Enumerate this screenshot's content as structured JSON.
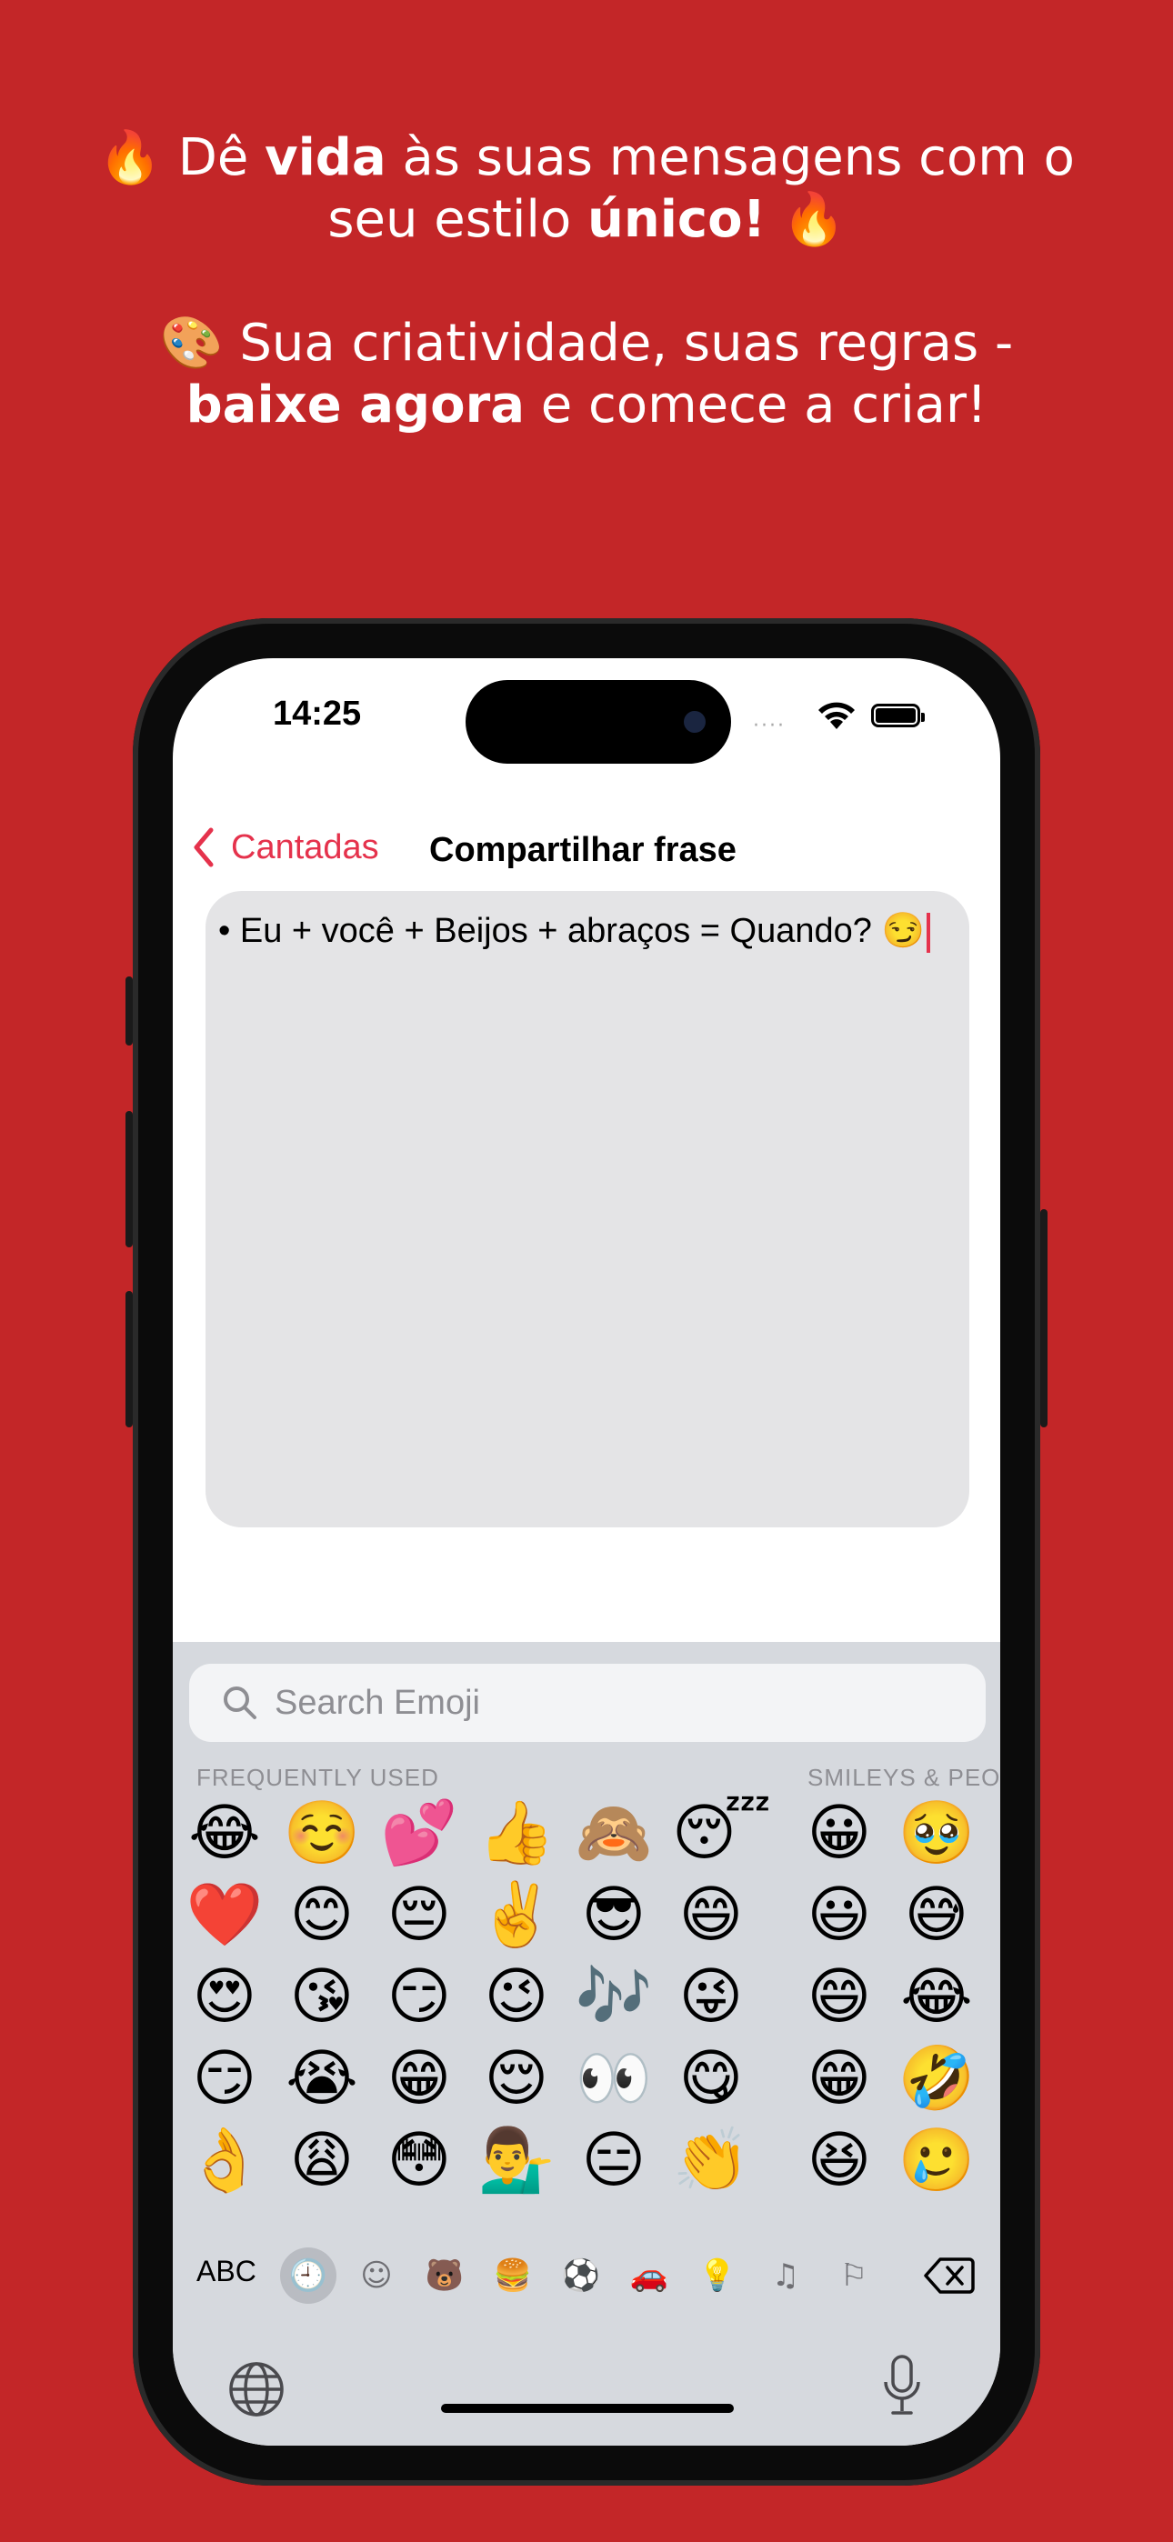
{
  "promo": {
    "line1_icon": "🔥",
    "line1_a": " Dê ",
    "line1_bold": "vida",
    "line1_b": " às suas mensagens com o",
    "line2_a": "seu estilo ",
    "line2_bold": "único!",
    "line2_icon": " 🔥",
    "line3_icon": "🎨",
    "line3_a": " Sua criatividade, suas regras -",
    "line4_bold": "baixe agora",
    "line4_a": " e comece a criar!"
  },
  "status": {
    "time": "14:25",
    "signal": "····"
  },
  "nav": {
    "back_label": "Cantadas",
    "title": "Compartilhar frase"
  },
  "text_area": {
    "value": "• Eu + você + Beijos + abraços = Quando? 😏"
  },
  "keyboard": {
    "search_placeholder": "Search Emoji",
    "section_frequent": "FREQUENTLY USED",
    "section_smileys": "SMILEYS & PEO",
    "emoji_rows": [
      [
        "😂",
        "☺️",
        "💕",
        "👍",
        "🙈",
        "😴",
        "😀",
        "🥹"
      ],
      [
        "❤️",
        "😊",
        "😔",
        "✌️",
        "😎",
        "😄",
        "😃",
        "😅"
      ],
      [
        "😍",
        "😘",
        "😏",
        "😉",
        "🎶",
        "😜",
        "😄",
        "😂"
      ],
      [
        "😏",
        "😭",
        "😁",
        "😌",
        "👀",
        "😋",
        "😁",
        "🤣"
      ],
      [
        "👌",
        "😩",
        "😳",
        "💁‍♂️",
        "😑",
        "👏",
        "😆",
        "🥲"
      ]
    ],
    "abc_label": "ABC",
    "categories": [
      "clock-icon",
      "smiley-icon",
      "bear-icon",
      "food-icon",
      "ball-icon",
      "car-icon",
      "bulb-icon",
      "symbols-icon",
      "flag-icon"
    ],
    "category_glyphs": [
      "🕘",
      "☺",
      "🐻",
      "🍔",
      "⚽",
      "🚗",
      "💡",
      "♫",
      "⚐"
    ],
    "delete_icon": "delete-icon"
  },
  "colors": {
    "background": "#C32628",
    "accent": "#E5324C"
  }
}
